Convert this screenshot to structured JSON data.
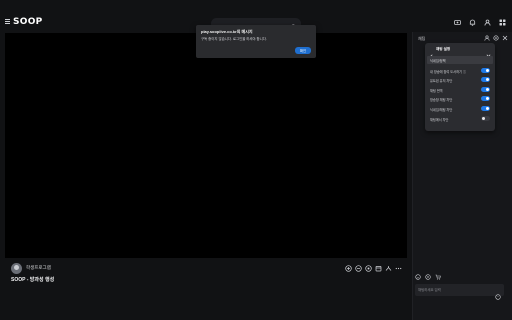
{
  "header": {
    "logo": "SOOP"
  },
  "alert": {
    "title": "play.sooplive.co.kr의 메시지",
    "message": "구독 중이지 않습니다. 로그인을 하셔야 합니다.",
    "ok_label": "확인"
  },
  "channel": {
    "name": "학생프로그램",
    "broadcast_title": "SOOP - 방과성 행성"
  },
  "chat": {
    "header_label": "채팅",
    "input_placeholder": "채팅하세요 입력",
    "settings": {
      "title": "채팅 설정",
      "section_label": "닉네임/정책",
      "rows": [
        {
          "label": "내 방송에 참여 도서하기 ⓘ",
          "enabled": true
        },
        {
          "label": "뮤트된 유저 차단",
          "enabled": true
        },
        {
          "label": "채팅 번역",
          "enabled": true
        },
        {
          "label": "방송창 채팅 차단",
          "enabled": true
        },
        {
          "label": "닉네임/채팅 차단",
          "enabled": true
        },
        {
          "label": "채팅에서 차단",
          "enabled": false
        }
      ]
    }
  },
  "colors": {
    "accent": "#1f7ae8",
    "background": "#111214"
  }
}
